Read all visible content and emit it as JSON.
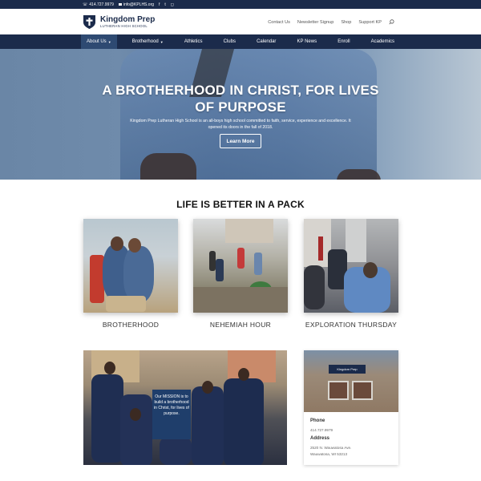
{
  "topbar": {
    "phone": "414.727.9979",
    "email": "info@KPLHS.org",
    "social": [
      "facebook-icon",
      "twitter-icon",
      "instagram-icon"
    ]
  },
  "header": {
    "brand_name": "Kingdom Prep",
    "brand_sub": "LUTHERAN HIGH SCHOOL",
    "links": [
      "Contact Us",
      "Newsletter Signup",
      "Shop",
      "Support KP"
    ]
  },
  "nav": {
    "items": [
      {
        "label": "About Us",
        "dropdown": true,
        "active": true
      },
      {
        "label": "Brotherhood",
        "dropdown": true,
        "active": false
      },
      {
        "label": "Athletics",
        "dropdown": false,
        "active": false
      },
      {
        "label": "Clubs",
        "dropdown": false,
        "active": false
      },
      {
        "label": "Calendar",
        "dropdown": false,
        "active": false
      },
      {
        "label": "KP News",
        "dropdown": false,
        "active": false
      },
      {
        "label": "Enroll",
        "dropdown": false,
        "active": false
      },
      {
        "label": "Academics",
        "dropdown": false,
        "active": false
      }
    ]
  },
  "hero": {
    "title": "A BROTHERHOOD IN CHRIST, FOR LIVES OF PURPOSE",
    "subtitle": "Kingdom Prep Lutheran High School is an all-boys high school committed to faith, service, experience and excellence. It opened its doors in the fall of 2018.",
    "button": "Learn More"
  },
  "section": {
    "title": "LIFE IS BETTER IN A PACK",
    "cards": [
      {
        "caption": "BROTHERHOOD"
      },
      {
        "caption": "NEHEMIAH HOUR"
      },
      {
        "caption": "EXPLORATION THURSDAY"
      }
    ]
  },
  "group_photo": {
    "sign": "Our MISSION is to build a brotherhood in Christ, for lives of purpose."
  },
  "contact": {
    "building_sign": "Kingdom Prep",
    "phone_label": "Phone",
    "phone": "414.727.9979",
    "address_label": "Address",
    "address_line1": "2520 N. Wauwatosa Ave.",
    "address_line2": "Wauwatosa, WI 53213"
  },
  "colors": {
    "navy": "#1b2b4b",
    "nav_active": "#2e4a72",
    "white": "#ffffff"
  }
}
